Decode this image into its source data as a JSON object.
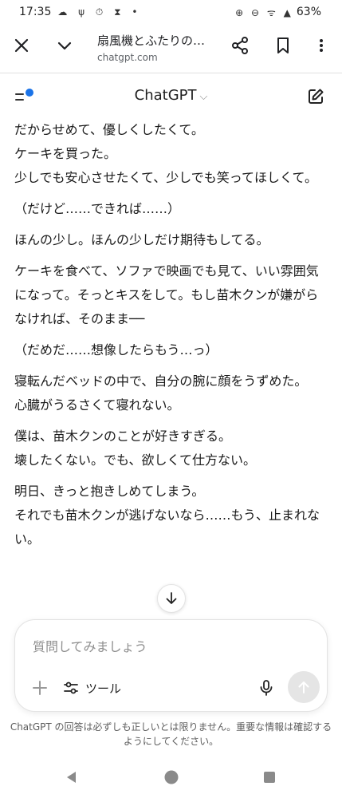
{
  "status_bar": {
    "time": "17:35",
    "left_icons": "☁ ψ ⏱ ⧗ •",
    "right_icons": "⊕ ⊖ ᯤ ▲",
    "battery": "63%"
  },
  "browser": {
    "page_title": "扇風機とふたりの…",
    "url": "chatgpt.com"
  },
  "chat_header": {
    "model_name": "ChatGPT",
    "model_chevron": "⌵"
  },
  "message": {
    "paragraphs": [
      "だからせめて、優しくしたくて。\nケーキを買った。\n少しでも安心させたくて、少しでも笑ってほしくて。",
      "（だけど……できれば……）",
      "ほんの少し。ほんの少しだけ期待もしてる。",
      "ケーキを食べて、ソファで映画でも見て、いい雰囲気になって。そっとキスをして。もし苗木クンが嫌がらなければ、そのまま──",
      "（だめだ……想像したらもう…っ）",
      "寝転んだベッドの中で、自分の腕に顔をうずめた。\n心臓がうるさくて寝れない。",
      "僕は、苗木クンのことが好きすぎる。\n壊したくない。でも、欲しくて仕方ない。",
      "明日、きっと抱きしめてしまう。\nそれでも苗木クンが逃げないなら……もう、止まれない。"
    ]
  },
  "composer": {
    "placeholder": "質問してみましょう",
    "tools_label": "ツール"
  },
  "disclaimer": "ChatGPT の回答は必ずしも正しいとは限りません。重要な情報は確認するようにしてください。",
  "colors": {
    "accent_dot": "#1a73e8",
    "send_bg": "#e5e5e5"
  }
}
